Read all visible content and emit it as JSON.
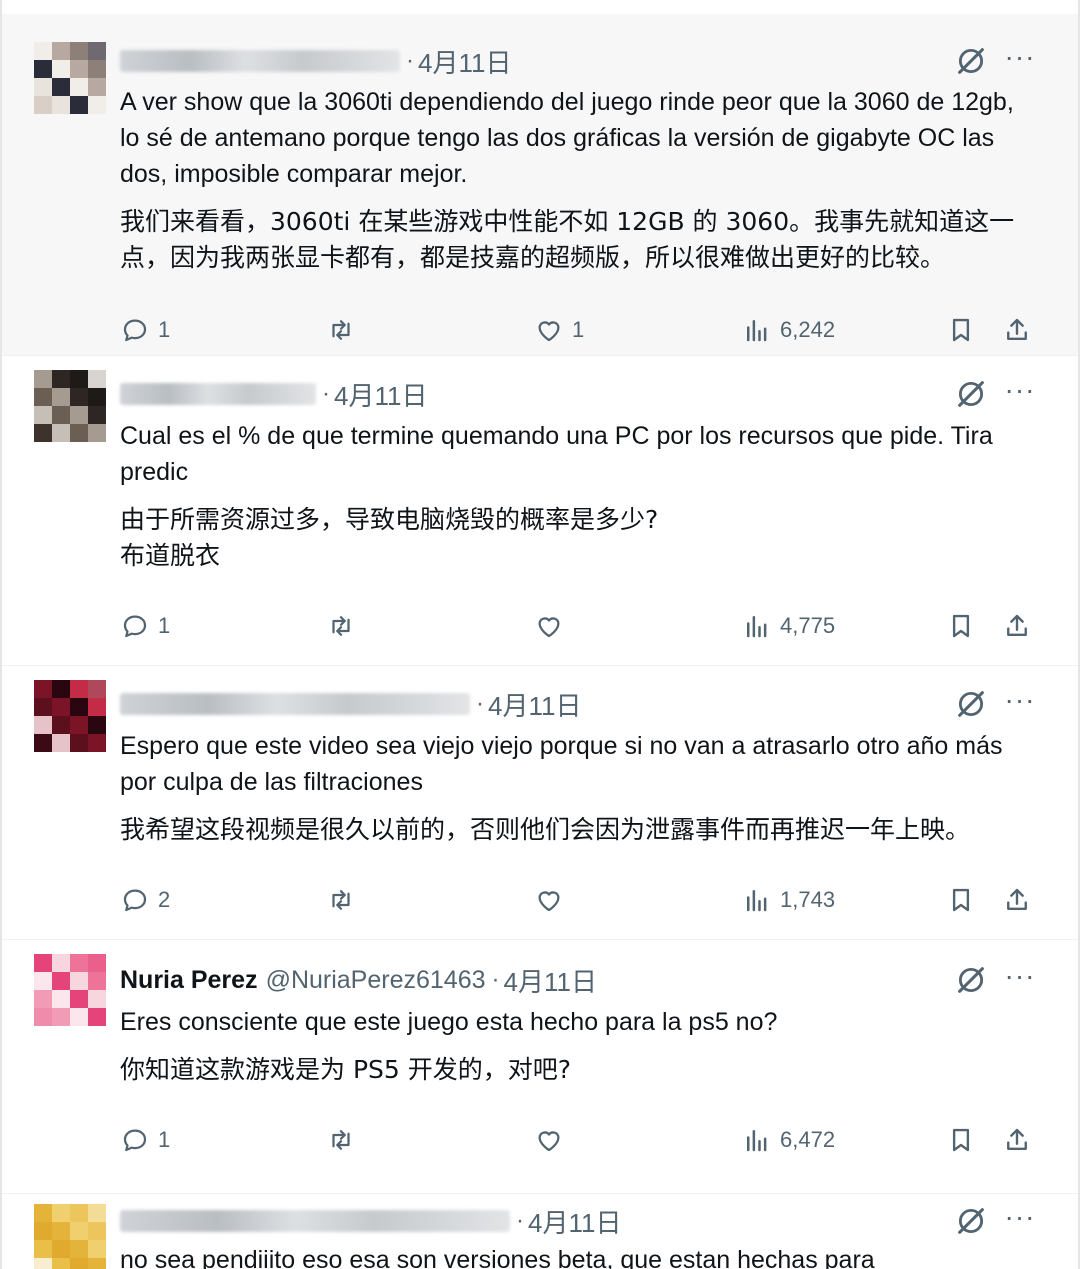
{
  "tweets": [
    {
      "name": "",
      "handle": "",
      "date": "4月11日",
      "text": "A ver show que la 3060ti dependiendo del juego rinde peor que la 3060 de 12gb, lo sé de antemano porque tengo las dos gráficas la versión de gigabyte OC las dos, imposible comparar mejor.",
      "translation": "我们来看看，3060ti 在某些游戏中性能不如 12GB 的 3060。我事先就知道这一点，因为我两张显卡都有，都是技嘉的超频版，所以很难做出更好的比较。",
      "replies": "1",
      "retweets": "",
      "likes": "1",
      "views": "6,242",
      "avatar_colors": [
        "#f1ede9",
        "#d9cfc7",
        "#8c8078",
        "#2a2c3a",
        "#55596a",
        "#b7a9a1",
        "#e9e3dd",
        "#6f6a72"
      ]
    },
    {
      "name": "",
      "handle": "",
      "date": "4月11日",
      "text": "Cual es el % de que termine quemando una PC por los recursos que pide. Tira predic",
      "translation": "由于所需资源过多，导致电脑烧毁的概率是多少?\n布道脱衣",
      "replies": "1",
      "retweets": "",
      "likes": "",
      "views": "4,775",
      "avatar_colors": [
        "#d9d4cf",
        "#a69b90",
        "#3d332c",
        "#1e1a17",
        "#6b5e53",
        "#8f8275",
        "#2d2622",
        "#c6bfb8"
      ]
    },
    {
      "name": "",
      "handle": "",
      "date": "4月11日",
      "text": "Espero que este video sea viejo viejo porque si no van a atrasarlo otro año más por culpa de las filtraciones",
      "translation": "我希望这段视频是很久以前的，否则他们会因为泄露事件而再推迟一年上映。",
      "replies": "2",
      "retweets": "",
      "likes": "",
      "views": "1,743",
      "avatar_colors": [
        "#e6c3c9",
        "#b0485b",
        "#7a1426",
        "#3b0a14",
        "#c42b46",
        "#5c0f1d",
        "#d98896",
        "#2a0710"
      ]
    },
    {
      "name": "Nuria Perez",
      "handle": "@NuriaPerez61463",
      "date": "4月11日",
      "text": "Eres consciente que este juego esta hecho para la ps5 no?",
      "translation": "你知道这款游戏是为 PS5 开发的，对吧?",
      "replies": "1",
      "retweets": "",
      "likes": "",
      "views": "6,472",
      "avatar_colors": [
        "#f7d6e0",
        "#f29bb7",
        "#ea5f8c",
        "#e5447a",
        "#f08cab",
        "#ee7399",
        "#fbe6ee",
        "#e85a88"
      ]
    },
    {
      "name": "",
      "handle": "",
      "date": "4月11日",
      "text": "no sea pendiiito eso esa son versiones beta, que estan hechas para",
      "translation": "",
      "replies": "",
      "retweets": "",
      "likes": "",
      "views": "",
      "avatar_colors": [
        "#f6e7c2",
        "#efcf6e",
        "#e9bf47",
        "#f3dc95",
        "#e4b33a",
        "#f8edd1",
        "#ecc65c",
        "#e0aa2e"
      ]
    }
  ],
  "icons": {
    "reply": "reply-icon",
    "retweet": "retweet-icon",
    "like": "heart-icon",
    "views": "views-chart-icon",
    "bookmark": "bookmark-icon",
    "share": "share-icon",
    "grok": "grok-icon",
    "more": "more-icon"
  },
  "colors": {
    "text": "#0f1419",
    "muted": "#536471",
    "shaded_bg": "#f7f7f8"
  }
}
